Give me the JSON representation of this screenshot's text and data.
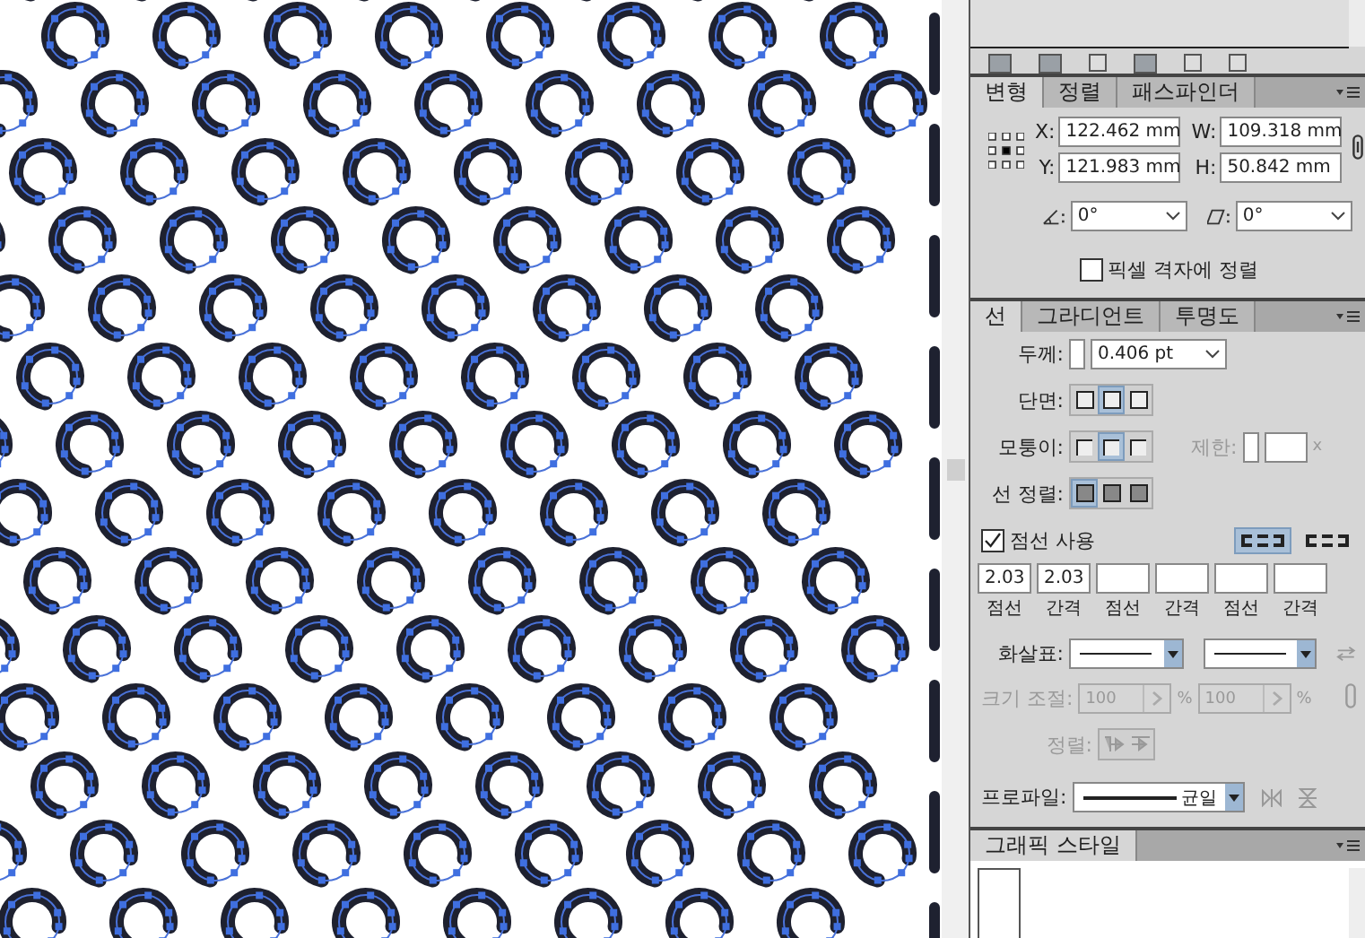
{
  "transform_panel": {
    "tabs": [
      {
        "label": "변형",
        "selected": true
      },
      {
        "label": "정렬",
        "selected": false
      },
      {
        "label": "패스파인더",
        "selected": false
      }
    ],
    "fields": [
      {
        "label": "X:",
        "value": "122.462 mm"
      },
      {
        "label": "W:",
        "value": "109.318 mm"
      },
      {
        "label": "Y:",
        "value": "121.983 mm"
      },
      {
        "label": "H:",
        "value": "50.842 mm"
      }
    ],
    "rotate": {
      "value": "0°"
    },
    "shear": {
      "value": "0°"
    },
    "pixel_grid": {
      "label": "픽셀 격자에 정렬",
      "checked": false
    }
  },
  "stroke_panel": {
    "tabs": [
      {
        "label": "선",
        "selected": true
      },
      {
        "label": "그라디언트",
        "selected": false
      },
      {
        "label": "투명도",
        "selected": false
      }
    ],
    "weight": {
      "label": "두께:",
      "value": "0.406 pt"
    },
    "cap": {
      "label": "단면:",
      "options": [
        {
          "selected": false
        },
        {
          "selected": true
        },
        {
          "selected": false
        }
      ]
    },
    "corner": {
      "label": "모퉁이:",
      "options": [
        {
          "selected": false
        },
        {
          "selected": true
        },
        {
          "selected": false
        }
      ]
    },
    "limit": {
      "label": "제한:",
      "suffix": "x",
      "disabled": true
    },
    "align": {
      "label": "선 정렬:",
      "options": [
        {
          "selected": true
        },
        {
          "selected": false
        },
        {
          "selected": false
        }
      ]
    },
    "dashed": {
      "label": "점선 사용",
      "checked": true,
      "modes": [
        {
          "selected": true
        },
        {
          "selected": false
        }
      ]
    },
    "dash_fields": [
      {
        "value": "2.03",
        "label": "점선"
      },
      {
        "value": "2.03",
        "label": "간격"
      },
      {
        "label": "점선"
      },
      {
        "label": "간격"
      },
      {
        "label": "점선"
      },
      {
        "label": "간격"
      }
    ],
    "arrowheads": {
      "label": "화살표:"
    },
    "scale": {
      "label": "크기 조절:",
      "disabled": true,
      "values": [
        {
          "value": "100",
          "unit": "%"
        },
        {
          "value": "100",
          "unit": "%"
        }
      ]
    },
    "arrow_align": {
      "label": "정렬:",
      "disabled": true
    },
    "profile": {
      "label": "프로파일:",
      "value": "균일"
    }
  },
  "graphic_styles_panel": {
    "tabs": [
      {
        "label": "그래픽 스타일",
        "selected": true
      }
    ]
  }
}
